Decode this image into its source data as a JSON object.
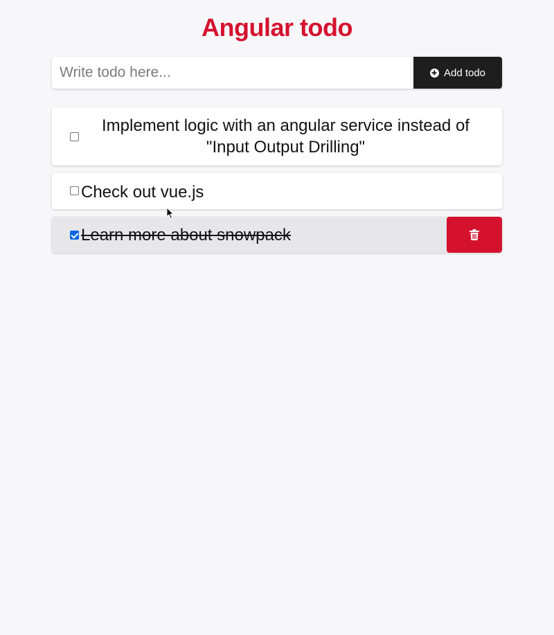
{
  "app": {
    "title": "Angular todo"
  },
  "add_form": {
    "placeholder": "Write todo here...",
    "value": "",
    "button_label": "Add todo",
    "button_icon": "plus-circle-icon"
  },
  "todos": [
    {
      "text": "Implement logic with an angular service instead of \"Input Output Drilling\"",
      "done": false
    },
    {
      "text": "Check out vue.js",
      "done": false
    },
    {
      "text": "Learn more about snowpack",
      "done": true,
      "delete_icon": "trash-icon"
    }
  ],
  "colors": {
    "accent": "#d5122e",
    "button_dark": "#1e1e1e",
    "checkbox_checked": "#0a66e4",
    "background": "#f7f6f8",
    "done_item_background": "#e7e6e9"
  }
}
